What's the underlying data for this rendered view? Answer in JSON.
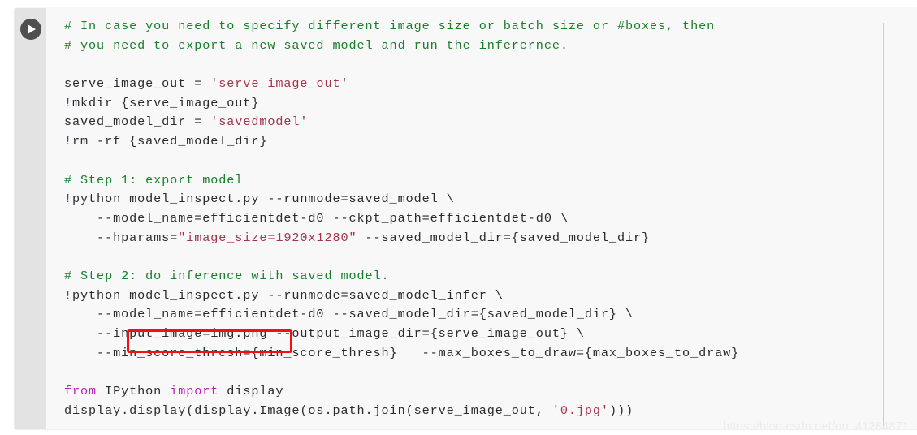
{
  "window": {
    "background": "#ffffff",
    "cell_background": "#f8f8f8",
    "gutter_background": "#e3e3e3"
  },
  "colors": {
    "comment": "#17802b",
    "string": "#a3344a",
    "keyword": "#bf1fbf",
    "shell_bang": "#3b3bc4",
    "plain_text": "#2b2b2b",
    "highlight_rect": "#f50f12",
    "watermark": "#ececec"
  },
  "toolbar": {
    "run_button_title": "Run cell",
    "run_icon": "play-triangle-icon"
  },
  "code": {
    "lines": [
      [
        {
          "t": "# In case you need to specify different image size or batch size or #boxes, then",
          "c": "comment"
        }
      ],
      [
        {
          "t": "# you need to export a new saved model and run the infererncе.",
          "c": "comment"
        }
      ],
      [
        {
          "t": "",
          "c": "plain"
        }
      ],
      [
        {
          "t": "serve_image_out = ",
          "c": "plain"
        },
        {
          "t": "'serve_image_out'",
          "c": "string"
        }
      ],
      [
        {
          "t": "!",
          "c": "bang"
        },
        {
          "t": "mkdir {serve_image_out}",
          "c": "plain"
        }
      ],
      [
        {
          "t": "saved_model_dir = ",
          "c": "plain"
        },
        {
          "t": "'savedmodel'",
          "c": "string"
        }
      ],
      [
        {
          "t": "!",
          "c": "bang"
        },
        {
          "t": "rm -rf {saved_model_dir}",
          "c": "plain"
        }
      ],
      [
        {
          "t": "",
          "c": "plain"
        }
      ],
      [
        {
          "t": "# Step 1: export model",
          "c": "comment"
        }
      ],
      [
        {
          "t": "!",
          "c": "bang"
        },
        {
          "t": "python model_inspect.py --runmode=saved_model \\",
          "c": "plain"
        }
      ],
      [
        {
          "t": "    --model_name=efficientdet-d0 --ckpt_path=efficientdet-d0 \\",
          "c": "plain"
        }
      ],
      [
        {
          "t": "    --hparams=",
          "c": "plain"
        },
        {
          "t": "\"image_size=1920x1280\"",
          "c": "string"
        },
        {
          "t": " --saved_model_dir={saved_model_dir}",
          "c": "plain"
        }
      ],
      [
        {
          "t": "",
          "c": "plain"
        }
      ],
      [
        {
          "t": "# Step 2: do inference with saved model.",
          "c": "comment"
        }
      ],
      [
        {
          "t": "!",
          "c": "bang"
        },
        {
          "t": "python model_inspect.py --runmode=saved_model_infer \\",
          "c": "plain"
        }
      ],
      [
        {
          "t": "    --model_name=efficientdet-d0 --saved_model_dir={saved_model_dir} \\",
          "c": "plain"
        }
      ],
      [
        {
          "t": "    --input_image=img.png --output_image_dir={serve_image_out} \\",
          "c": "plain"
        }
      ],
      [
        {
          "t": "    --min_score_thresh={min_score_thresh}   --max_boxes_to_draw={max_boxes_to_draw}",
          "c": "plain"
        }
      ],
      [
        {
          "t": "",
          "c": "plain"
        }
      ],
      [
        {
          "t": "from",
          "c": "keyword"
        },
        {
          "t": " IPython ",
          "c": "plain"
        },
        {
          "t": "import",
          "c": "keyword"
        },
        {
          "t": " display",
          "c": "plain"
        }
      ],
      [
        {
          "t": "display.display(display.Image(os.path.join(serve_image_out, ",
          "c": "plain"
        },
        {
          "t": "'0.jpg'",
          "c": "string"
        },
        {
          "t": ")))",
          "c": "plain"
        }
      ]
    ]
  },
  "annotation": {
    "highlighted_text": "--input_image=img.png",
    "shape": "rectangle"
  },
  "watermark": {
    "text": "https://blog.csdn.net/qq_41284871"
  }
}
